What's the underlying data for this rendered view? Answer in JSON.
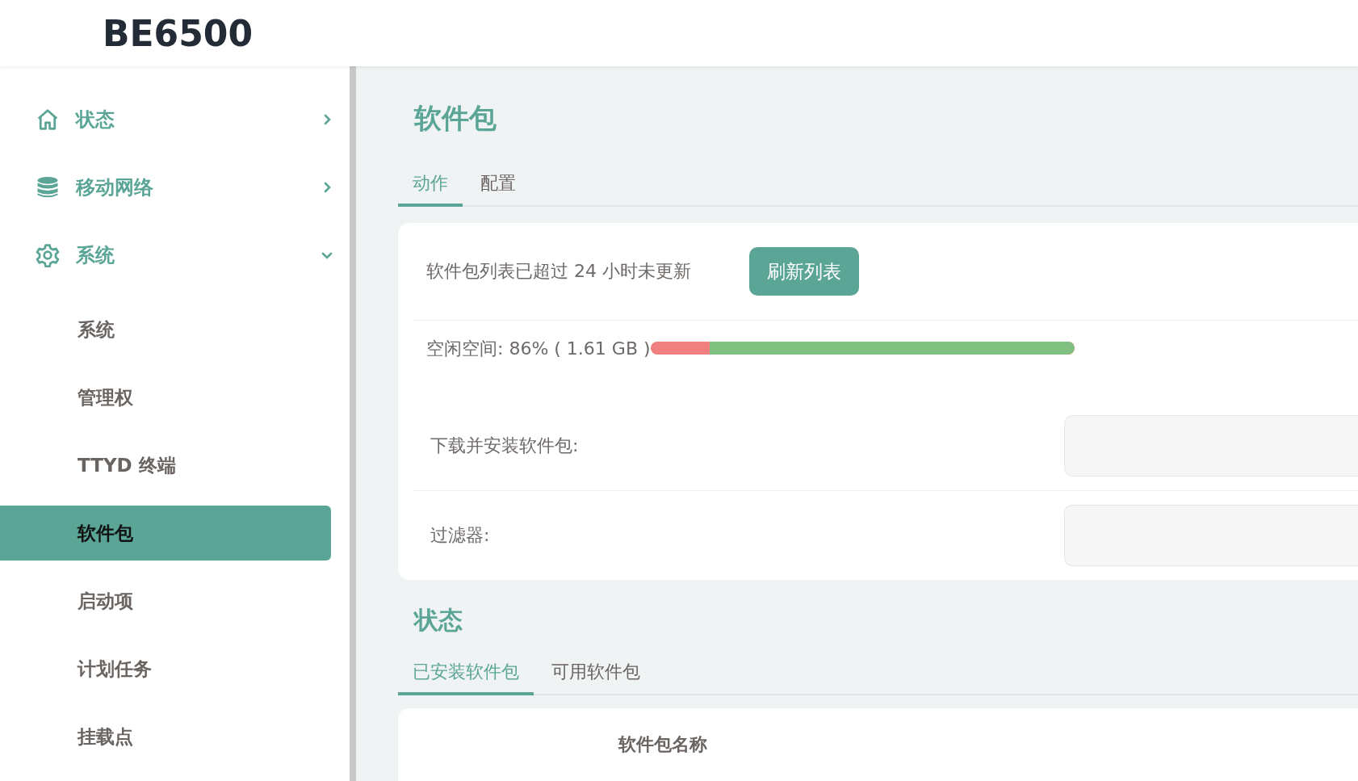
{
  "logo": "BE6500",
  "sidebar": {
    "items": [
      {
        "label": "状态",
        "expanded": false
      },
      {
        "label": "移动网络",
        "expanded": false
      },
      {
        "label": "系统",
        "expanded": true,
        "children": [
          {
            "label": "系统",
            "selected": false
          },
          {
            "label": "管理权",
            "selected": false
          },
          {
            "label": "TTYD 终端",
            "selected": false
          },
          {
            "label": "软件包",
            "selected": true
          },
          {
            "label": "启动项",
            "selected": false
          },
          {
            "label": "计划任务",
            "selected": false
          },
          {
            "label": "挂载点",
            "selected": false
          }
        ]
      }
    ]
  },
  "page": {
    "title": "软件包",
    "tabs": [
      {
        "label": "动作",
        "selected": true
      },
      {
        "label": "配置",
        "selected": false
      }
    ],
    "notice": "软件包列表已超过 24 小时未更新",
    "refresh_button": "刷新列表",
    "free_space": {
      "label": "空闲空间: 86% ( 1.61 GB )",
      "level": 0.86
    },
    "fields": [
      {
        "label": "下载并安装软件包:"
      },
      {
        "label": "过滤器:"
      }
    ]
  },
  "status": {
    "title": "状态",
    "tabs": [
      {
        "label": "已安装软件包",
        "selected": true
      },
      {
        "label": "可用软件包",
        "selected": false
      }
    ],
    "table": {
      "columns": [
        "软件包名称"
      ]
    }
  }
}
